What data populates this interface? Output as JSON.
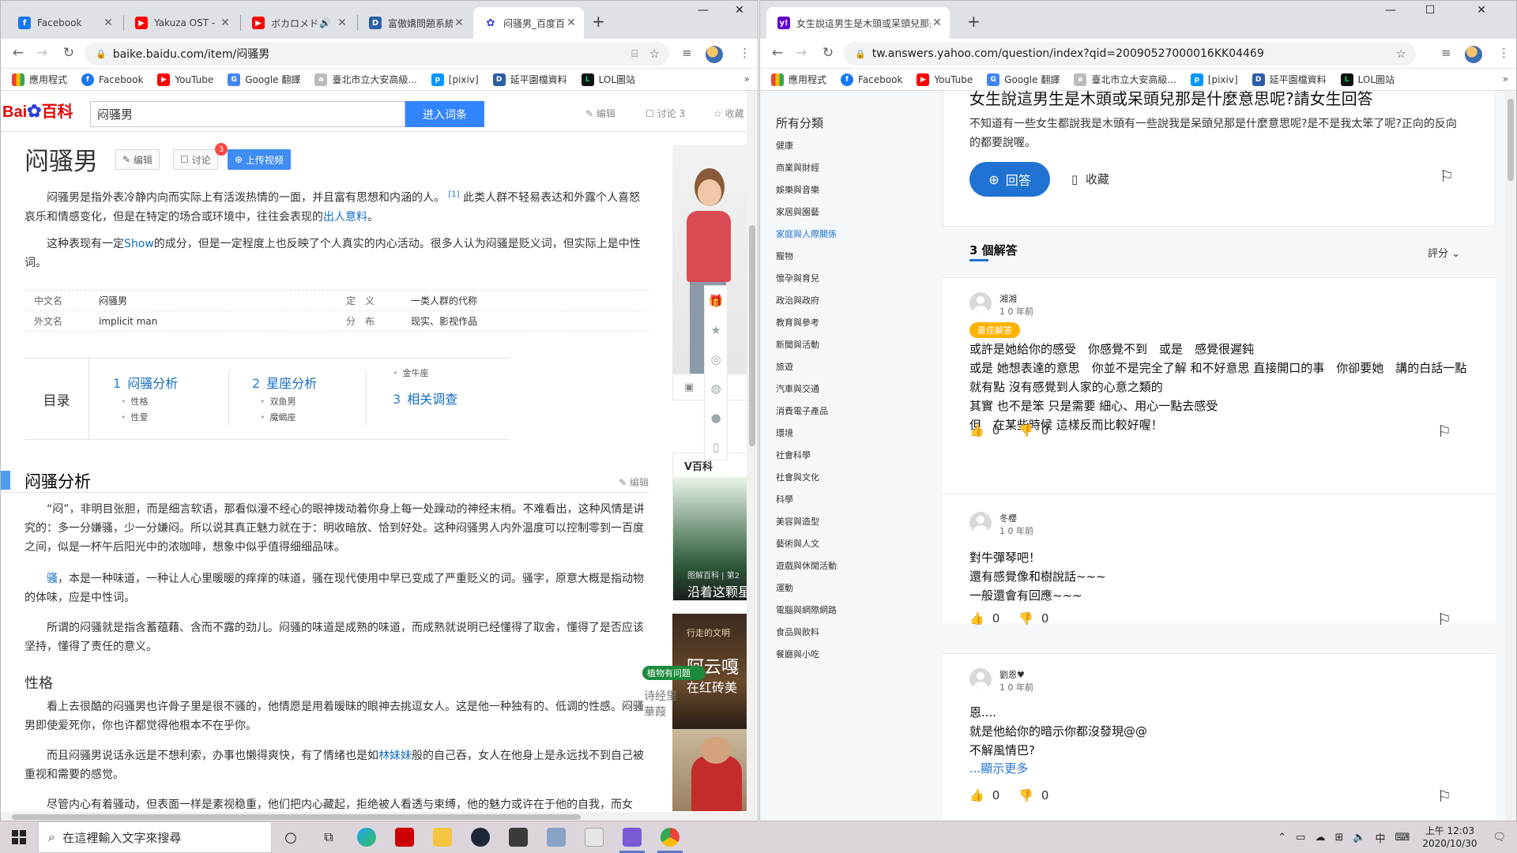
{
  "left": {
    "tabs": [
      {
        "title": "Facebook",
        "color": "#1877f2",
        "glyph": "f"
      },
      {
        "title": "Yakuza OST - B",
        "color": "#ff0000",
        "glyph": "▶"
      },
      {
        "title": "ボカロメドレー",
        "color": "#ff0000",
        "glyph": "▶"
      },
      {
        "title": "富傲嬌問題系統",
        "color": "#2b5ea7",
        "glyph": "D"
      },
      {
        "title": "闷骚男_百度百科",
        "color": "#2d3fd6",
        "glyph": "🐾"
      }
    ],
    "new_tab": "+",
    "url": "baike.baidu.com/item/闷骚男",
    "bookmarks": [
      {
        "label": "應用程式",
        "color": "#555"
      },
      {
        "label": "Facebook",
        "color": "#1877f2"
      },
      {
        "label": "YouTube",
        "color": "#ff0000"
      },
      {
        "label": "Google 翻譯",
        "color": "#4285f4"
      },
      {
        "label": "臺北市立大安高級...",
        "color": "#888"
      },
      {
        "label": "[pixiv]",
        "color": "#0096fa"
      },
      {
        "label": "延平園檔資料",
        "color": "#2b5ea7"
      },
      {
        "label": "LOL圖站",
        "color": "#0a3"
      }
    ],
    "baidu": {
      "logo_text": "Bai",
      "logo_paw": "🐾",
      "logo_after": "百科",
      "search_value": "闷骚男",
      "search_button": "进入词条",
      "top_edit": "编辑",
      "top_discuss": "讨论 3",
      "top_collect": "收藏",
      "title": "闷骚男",
      "chip_edit": "编辑",
      "chip_discuss": "讨论",
      "chip_badge": "3",
      "chip_video": "上传视频",
      "para1a": "闷骚男是指外表冷静内向而实际上有活泼热情的一面，并且富有思想和内涵的人。",
      "para1_sup": "[1]",
      "para1b": "此类人群不轻易表达和外露个人喜怒哀乐和情感变化，但是在特定的场合或环境中，往往会表现的",
      "para1_link": "出人意料",
      "para1c": "。",
      "para2a": "这种表现有一定",
      "para2_link": "Show",
      "para2b": "的成分，但是一定程度上也反映了个人真实的内心活动。很多人认为闷骚是贬义词，但实际上是中性词。",
      "info": [
        {
          "k1": "中文名",
          "v1": "闷骚男",
          "k2": "定　义",
          "v2": "一类人群的代称"
        },
        {
          "k1": "外文名",
          "v1": "implicit man",
          "k2": "分　布",
          "v2": "现实、影视作品"
        }
      ],
      "toc_label": "目录",
      "toc": [
        {
          "n": "1",
          "t": "闷骚分析",
          "subs": [
            "性格",
            "性爱"
          ]
        },
        {
          "n": "2",
          "t": "星座分析",
          "subs": [
            "双鱼男",
            "魔蝎座"
          ]
        },
        {
          "n": "3",
          "t": "相关调查",
          "subs": []
        }
      ],
      "toc_extra": "金牛座",
      "section_title": "闷骚分析",
      "section_edit": "编辑",
      "s_p1": "“闷”，非明目张胆，而是细言软语，那看似漫不经心的眼神拨动着你身上每一处躁动的神经末梢。不难看出，这种风情是讲究的：多一分嫌骚，少一分嫌闷。所以说其真正魅力就在于：明收暗放、恰到好处。这种闷骚男人内外温度可以控制零到一百度之间，似是一杯午后阳光中的浓咖啡，想象中似乎值得细细品味。",
      "s_p2_link": "骚",
      "s_p2": "，本是一种味道，一种让人心里暖暖的痒痒的味道，骚在现代使用中早已变成了严重贬义的词。骚字，原意大概是指动物的体味，应是中性词。",
      "s_p3": "所谓的闷骚就是指含蓄蕴藉、含而不露的劲儿。闷骚的味道是成熟的味道，而成熟就说明已经懂得了取舍，懂得了是否应该坚持，懂得了责任的意义。",
      "h3": "性格",
      "s_p4": "看上去很酷的闷骚男也许骨子里是很不骚的，他情愿是用着暧昧的眼神去挑逗女人。这是他一种独有的、低调的性感。闷骚男即使爱死你，你也许都觉得他根本不在乎你。",
      "s_p5a": "而且闷骚男说话永远是不想利索，办事也懒得爽快，有了情绪也是如",
      "s_p5_link": "林妹妹",
      "s_p5b": "般的自己吞，女人在他身上是永远找不到自己被重视和需要的感觉。",
      "s_p6": "尽管内心有着骚动，但表面一样是素视稳重，他们把内心藏起，拒绝被人看透与束缚，他的魅力或许在于他的自我，而女",
      "side_ad_label": "V百科",
      "side_ad_caption1": "图解百科 | 第2",
      "side_ad_caption2": "沿着这颗星",
      "side_ad2_title": "阿云嘎",
      "side_ad2_sub": "在红砖美",
      "side_ad2_tag": "行走的文明",
      "side_ad3_title": "植物有问题",
      "side_ad3_sub": "诗经里",
      "side_ad3_sub2": "華葭",
      "side_img_label": "男"
    }
  },
  "right": {
    "tab_title": "女生說這男生是木頭或呆頭兒那是",
    "new_tab": "+",
    "url": "tw.answers.yahoo.com/question/index?qid=20090527000016KK04469",
    "bookmarks": [
      {
        "label": "應用程式",
        "color": "#555"
      },
      {
        "label": "Facebook",
        "color": "#1877f2"
      },
      {
        "label": "YouTube",
        "color": "#ff0000"
      },
      {
        "label": "Google 翻譯",
        "color": "#4285f4"
      },
      {
        "label": "臺北市立大安高級...",
        "color": "#888"
      },
      {
        "label": "[pixiv]",
        "color": "#0096fa"
      },
      {
        "label": "延平園檔資料",
        "color": "#2b5ea7"
      },
      {
        "label": "LOL圖站",
        "color": "#0a3"
      }
    ],
    "sidebar_title": "所有分類",
    "categories": [
      "健康",
      "商業與財經",
      "娛樂與音樂",
      "家居與園藝",
      "家庭與人際關係",
      "寵物",
      "懷孕與育兒",
      "政治與政府",
      "教育與參考",
      "新聞與活動",
      "旅遊",
      "汽車與交通",
      "消費電子產品",
      "環境",
      "社會科學",
      "社會與文化",
      "科學",
      "美容與造型",
      "藝術與人文",
      "遊戲與休閒活動",
      "運動",
      "電腦與網際網路",
      "食品與飲料",
      "餐廳與小吃"
    ],
    "selected_category": "家庭與人際關係",
    "question_title": "女生說這男生是木頭或呆頭兒那是什麼意思呢?請女生回答",
    "question_detail": "不知道有一些女生都說我是木頭有一些說我是呆頭兒那是什麼意思呢?是不是我太笨了呢?正向的反向的都要說喔。",
    "answer_button": "回答",
    "collect_button": "收藏",
    "answer_count": "3 個解答",
    "sort_label": "評分",
    "answers": [
      {
        "name": "湘湘",
        "time": "1 0 年前",
        "best": "最佳解答",
        "text": "或許是她給你的感受　你感覺不到　或是　感覺很遲鈍\n或是 她想表達的意思　你並不是完全了解 和不好意思 直接開口的事　你卻要她　講的白話一點　就有點 沒有感覺到人家的心意之類的\n其實 也不是笨 只是需要 細心、用心一點去感受\n但　在某些時候 這樣反而比較好喔！",
        "up": "0",
        "down": "0",
        "more": ""
      },
      {
        "name": "冬櫻",
        "time": "1 0 年前",
        "best": "",
        "text": "對牛彈琴吧！\n還有感覺像和樹說話~~~\n一般還會有回應~~~",
        "up": "0",
        "down": "0",
        "more": ""
      },
      {
        "name": "劉恩♥",
        "time": "1 0 年前",
        "best": "",
        "text": "恩....\n就是他給你的暗示你都沒發現@@\n不解風情巴?",
        "up": "0",
        "down": "0",
        "more": "...顯示更多"
      }
    ]
  },
  "taskbar": {
    "search_placeholder": "在這裡輸入文字來搜尋",
    "time": "上午 12:03",
    "date": "2020/10/30",
    "ime": "中"
  }
}
